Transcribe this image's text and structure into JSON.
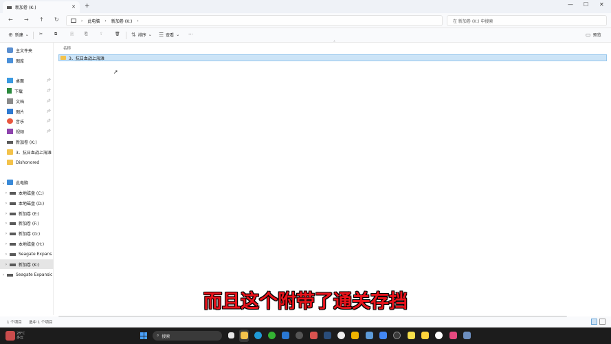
{
  "tab": {
    "title": "新加卷 (K:)",
    "close": "✕",
    "new_tab": "+"
  },
  "window": {
    "minimize": "—",
    "maximize": "☐",
    "close": "✕"
  },
  "nav": {
    "back": "←",
    "forward": "→",
    "up": "↑",
    "refresh": "↻"
  },
  "address": {
    "crumbs": [
      "此电脑",
      "新加卷 (K:)"
    ],
    "sep": "›"
  },
  "search": {
    "placeholder": "在 新加卷 (K:) 中搜索"
  },
  "commands": {
    "new": "新建",
    "sort": "排序",
    "view": "查看",
    "more": "···",
    "preview": "预览"
  },
  "sidebar": {
    "quick": [
      {
        "label": "主文件夹"
      },
      {
        "label": "图库"
      }
    ],
    "pinned": [
      {
        "label": "桌面"
      },
      {
        "label": "下载"
      },
      {
        "label": "文档"
      },
      {
        "label": "图片"
      },
      {
        "label": "音乐"
      },
      {
        "label": "视频"
      },
      {
        "label": "新加卷 (K:)"
      },
      {
        "label": "3、抗日血战上海滩"
      },
      {
        "label": "Dishonored"
      }
    ],
    "pc": {
      "label": "此电脑"
    },
    "drives": [
      {
        "label": "本地磁盘 (C:)"
      },
      {
        "label": "本地磁盘 (D:)"
      },
      {
        "label": "新加卷 (E:)"
      },
      {
        "label": "新加卷 (F:)"
      },
      {
        "label": "新加卷 (G:)"
      },
      {
        "label": "本地磁盘 (H:)"
      },
      {
        "label": "Seagate Expans"
      },
      {
        "label": "新加卷 (K:)"
      }
    ],
    "external": {
      "label": "Seagate Expansic"
    }
  },
  "content": {
    "column_name": "名称",
    "items": [
      {
        "name": "3、抗日血战上海滩"
      }
    ]
  },
  "subtitle": "而且这个附带了通关存挡",
  "status": {
    "count": "1 个项目",
    "selected": "选中 1 个项目"
  },
  "taskbar": {
    "search_label": "搜索",
    "weather_temp": "28°C",
    "weather_desc": "多云"
  }
}
